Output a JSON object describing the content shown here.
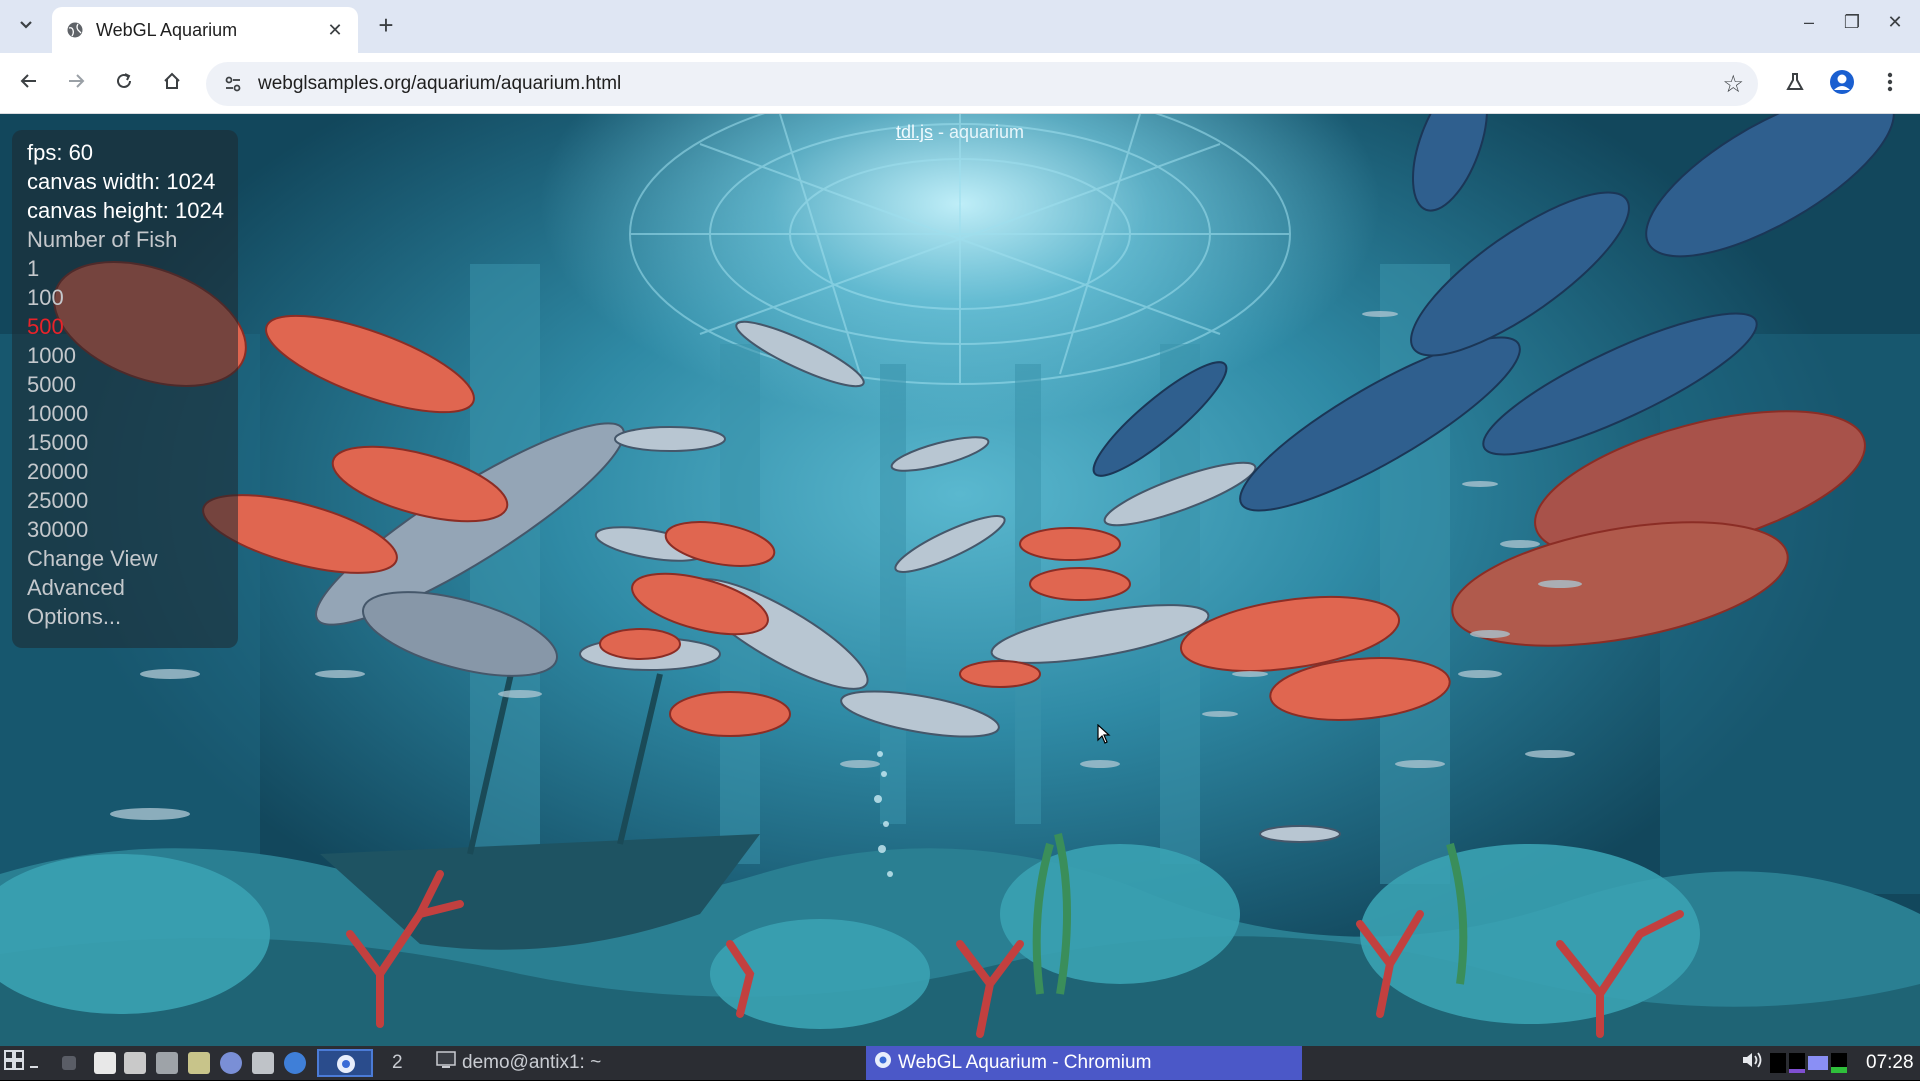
{
  "browser": {
    "tab_title": "WebGL Aquarium",
    "url": "webglsamples.org/aquarium/aquarium.html",
    "new_tab_label": "+",
    "close_tab_label": "✕",
    "window_controls": {
      "minimize": "–",
      "maximize": "❐",
      "close": "✕"
    }
  },
  "page": {
    "title_link": "tdl.js",
    "title_suffix": " - aquarium"
  },
  "hud": {
    "fps": "fps: 60",
    "canvas_width": "canvas width: 1024",
    "canvas_height": "canvas height: 1024",
    "number_of_fish_label": "Number of Fish",
    "fish_options": [
      "1",
      "100",
      "500",
      "1000",
      "5000",
      "10000",
      "15000",
      "20000",
      "25000",
      "30000"
    ],
    "selected_fish_option": "500",
    "change_view": "Change View",
    "advanced": "Advanced",
    "options": "Options..."
  },
  "taskbar": {
    "workspace_number": "2",
    "terminal_label": "demo@antix1: ~",
    "active_window_label": "WebGL Aquarium - Chromium",
    "clock": "07:28"
  },
  "colors": {
    "selected_option": "#e8232a",
    "taskbar_active": "#4b58c8",
    "taskbar_bg": "#2b2d33"
  }
}
